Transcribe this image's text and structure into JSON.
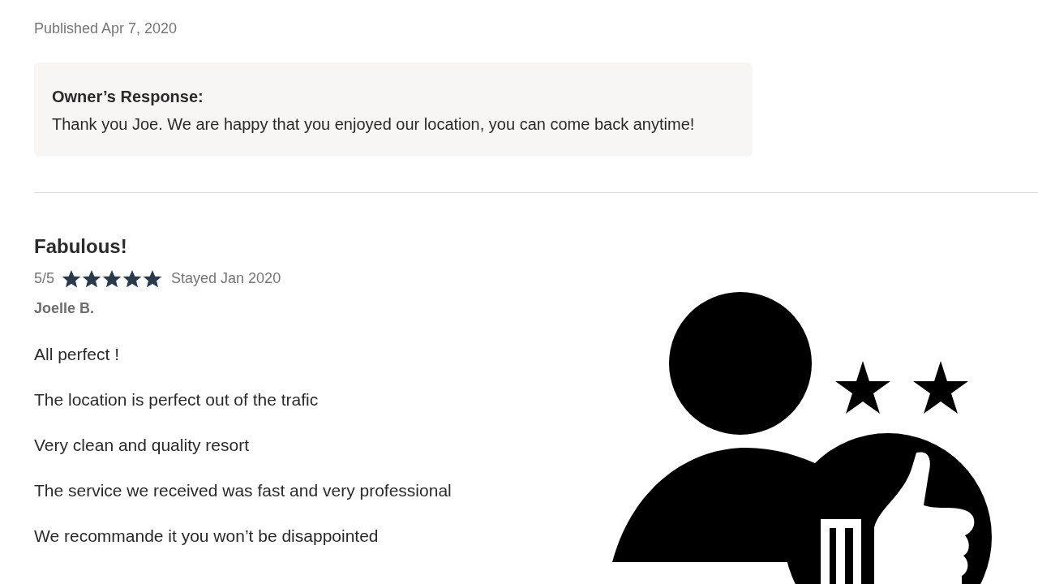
{
  "published": "Published Apr 7, 2020",
  "owner_response": {
    "label": "Owner’s Response:",
    "text": "Thank you Joe. We are happy that you enjoyed our location, you can come back anytime!"
  },
  "review": {
    "title": "Fabulous!",
    "score": "5/5",
    "stars": 5,
    "stayed": "Stayed Jan 2020",
    "author": "Joelle B.",
    "paragraphs": [
      "All perfect !",
      "The location is perfect out of the trafic",
      "Very clean and quality resort",
      "The service we received was fast and very professional",
      "We recommande it you won’t be disappointed"
    ]
  }
}
